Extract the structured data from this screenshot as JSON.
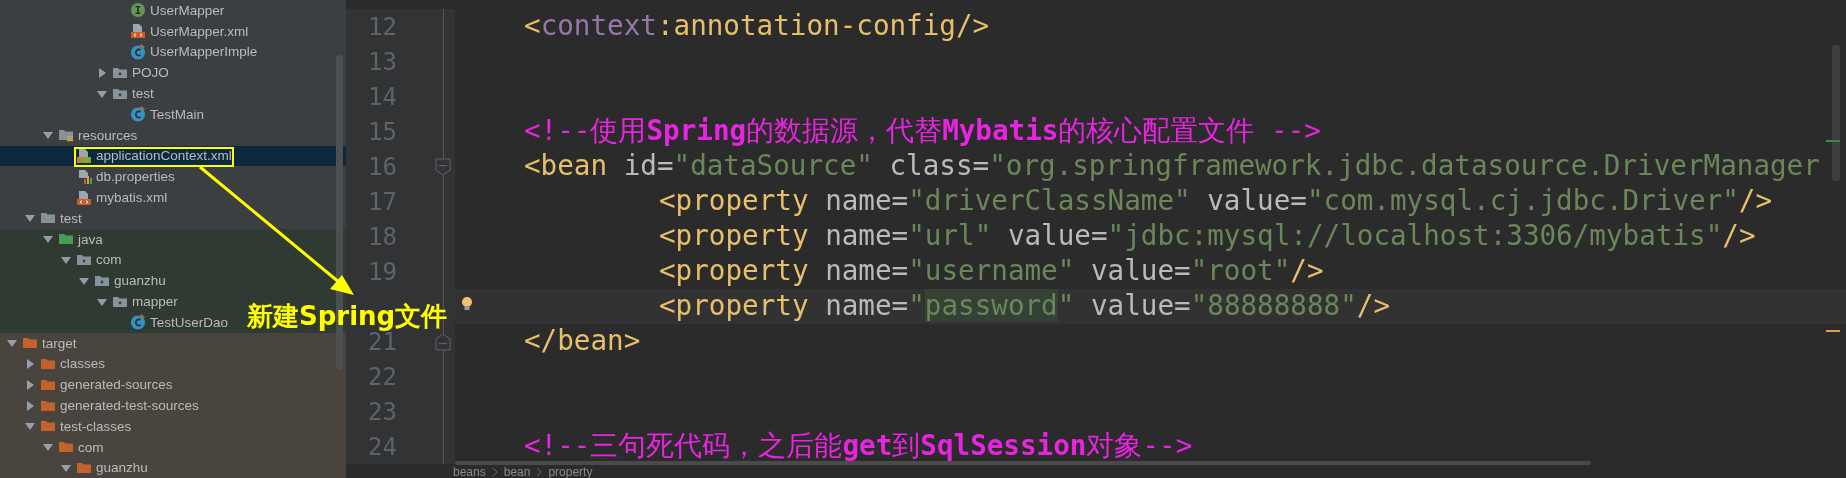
{
  "project_tree": [
    {
      "children": [
        {
          "children": [
            {
              "children": [
                {
                  "children": [
                    {
                      "children": [
                        {
                          "children": [
                            {
                              "label": "UserMapper",
                              "kind": "interface",
                              "selected": false
                            },
                            {
                              "label": "UserMapper.xml",
                              "kind": "xml",
                              "selected": false
                            },
                            {
                              "label": "UserMapperImple",
                              "kind": "class",
                              "selected": false
                            }
                          ]
                        },
                        {
                          "label": "POJO",
                          "kind": "package",
                          "expanded": false,
                          "selected": false
                        },
                        {
                          "label": "test",
                          "kind": "package",
                          "expanded": true,
                          "selected": false,
                          "children": [
                            {
                              "label": "TestMain",
                              "kind": "class",
                              "selected": false
                            }
                          ]
                        }
                      ]
                    }
                  ]
                }
              ]
            },
            {
              "label": "resources",
              "kind": "resources-root",
              "expanded": true,
              "selected": false,
              "children": [
                {
                  "label": "applicationContext.xml",
                  "kind": "spring-xml",
                  "selected": true
                },
                {
                  "label": "db.properties",
                  "kind": "properties",
                  "selected": false
                },
                {
                  "label": "mybatis.xml",
                  "kind": "xml",
                  "selected": false
                }
              ]
            }
          ]
        },
        {
          "label": "test",
          "kind": "folder",
          "expanded": true,
          "selected": false,
          "children": [
            {
              "label": "java",
              "kind": "test-source-root",
              "color": "#2f3a32",
              "expanded": true,
              "selected": false,
              "children": [
                {
                  "label": "com",
                  "kind": "package",
                  "color": "#2f3a32",
                  "expanded": true,
                  "selected": false,
                  "children": [
                    {
                      "label": "guanzhu",
                      "kind": "package",
                      "color": "#2f3a32",
                      "expanded": true,
                      "selected": false,
                      "children": [
                        {
                          "label": "mapper",
                          "kind": "package",
                          "color": "#2f3a32",
                          "expanded": true,
                          "selected": false,
                          "children": [
                            {
                              "label": "TestUserDao",
                              "kind": "class",
                              "color": "#2f3a32",
                              "selected": false
                            }
                          ]
                        }
                      ]
                    }
                  ]
                }
              ]
            }
          ]
        }
      ]
    },
    {
      "label": "target",
      "kind": "excluded-folder",
      "color": "#49453e",
      "expanded": true,
      "selected": false,
      "children": [
        {
          "label": "classes",
          "kind": "excluded-folder",
          "color": "#49453e",
          "expanded": false,
          "selected": false
        },
        {
          "label": "generated-sources",
          "kind": "excluded-folder",
          "color": "#49453e",
          "expanded": false,
          "selected": false
        },
        {
          "label": "generated-test-sources",
          "kind": "excluded-folder",
          "color": "#49453e",
          "expanded": false,
          "selected": false
        },
        {
          "label": "test-classes",
          "kind": "excluded-folder",
          "color": "#49453e",
          "expanded": true,
          "selected": false,
          "children": [
            {
              "label": "com",
              "kind": "excluded-folder",
              "color": "#49453e",
              "expanded": true,
              "selected": false,
              "children": [
                {
                  "label": "guanzhu",
                  "kind": "excluded-folder",
                  "color": "#49453e",
                  "expanded": true,
                  "selected": false
                }
              ]
            }
          ]
        }
      ]
    }
  ],
  "editor": {
    "lines": [
      {
        "number": "12",
        "kind": "plain",
        "current": false,
        "indented": false,
        "tokens": [
          {
            "kind": "tag",
            "text": "<"
          },
          {
            "kind": "ns",
            "text": "context"
          },
          {
            "kind": "tag",
            "text": ":annotation-config/>"
          }
        ]
      },
      {
        "number": "13",
        "kind": "plain",
        "current": false
      },
      {
        "number": "14",
        "kind": "plain",
        "current": false
      },
      {
        "number": "15",
        "kind": "plain",
        "current": false,
        "indented": false,
        "tokens": [
          {
            "kind": "comment",
            "text": "<!--使用**Spring**的数据源，代替**Mybatis**的核心配置文件 -->"
          }
        ]
      },
      {
        "number": "16",
        "kind": "fold-start",
        "current": false,
        "indented": false,
        "tokens": [
          {
            "kind": "tag",
            "text": "<bean"
          },
          {
            "kind": "attr",
            "text": " id="
          },
          {
            "kind": "value",
            "text": "\"dataSource\""
          },
          {
            "kind": "attr",
            "text": " class="
          },
          {
            "kind": "value",
            "text": "\"org.springframework.jdbc.datasource.DriverManager"
          }
        ]
      },
      {
        "number": "17",
        "kind": "plain",
        "current": false,
        "indented": true,
        "tokens": [
          {
            "kind": "tag",
            "text": "<property"
          },
          {
            "kind": "attr",
            "text": " name="
          },
          {
            "kind": "value",
            "text": "\"driverClassName\""
          },
          {
            "kind": "attr",
            "text": " value="
          },
          {
            "kind": "value",
            "text": "\"com.mysql.cj.jdbc.Driver\""
          },
          {
            "kind": "tag",
            "text": "/>"
          }
        ]
      },
      {
        "number": "18",
        "kind": "plain",
        "current": false,
        "indented": true,
        "tokens": [
          {
            "kind": "tag",
            "text": "<property"
          },
          {
            "kind": "attr",
            "text": " name="
          },
          {
            "kind": "value",
            "text": "\"url\""
          },
          {
            "kind": "attr",
            "text": " value="
          },
          {
            "kind": "value",
            "text": "\"jdbc:mysql://localhost:3306/mybatis\""
          },
          {
            "kind": "tag",
            "text": "/>"
          }
        ]
      },
      {
        "number": "19",
        "kind": "plain",
        "current": false,
        "indented": true,
        "tokens": [
          {
            "kind": "tag",
            "text": "<property"
          },
          {
            "kind": "attr",
            "text": " name="
          },
          {
            "kind": "value",
            "text": "\"username\""
          },
          {
            "kind": "attr",
            "text": " value="
          },
          {
            "kind": "value",
            "text": "\"root\""
          },
          {
            "kind": "tag",
            "text": "/>"
          }
        ]
      },
      {
        "kind": "plain",
        "current": true,
        "indented": true,
        "tokens": [
          {
            "kind": "tag",
            "text": "<property"
          },
          {
            "kind": "attr",
            "text": " name="
          },
          {
            "kind": "value",
            "text": "\""
          },
          {
            "kind": "match",
            "text": "password"
          },
          {
            "kind": "value",
            "text": "\""
          },
          {
            "kind": "attr",
            "text": " value="
          },
          {
            "kind": "value",
            "text": "\"88888888\""
          },
          {
            "kind": "tag",
            "text": "/>"
          }
        ]
      },
      {
        "number": "21",
        "kind": "fold-end",
        "current": false,
        "indented": false,
        "tokens": [
          {
            "kind": "tag",
            "text": "</bean>"
          }
        ]
      },
      {
        "number": "22",
        "kind": "plain",
        "current": false
      },
      {
        "number": "23",
        "kind": "plain",
        "current": false
      },
      {
        "number": "24",
        "kind": "plain",
        "current": false,
        "indented": false,
        "tokens": [
          {
            "kind": "comment",
            "text": "<!--三句死代码，之后能**get**到**SqlSession**对象-->"
          }
        ]
      }
    ]
  },
  "breadcrumbs": [
    "beans",
    "bean",
    "property"
  ],
  "annotation": {
    "label": "新建Spring文件"
  }
}
